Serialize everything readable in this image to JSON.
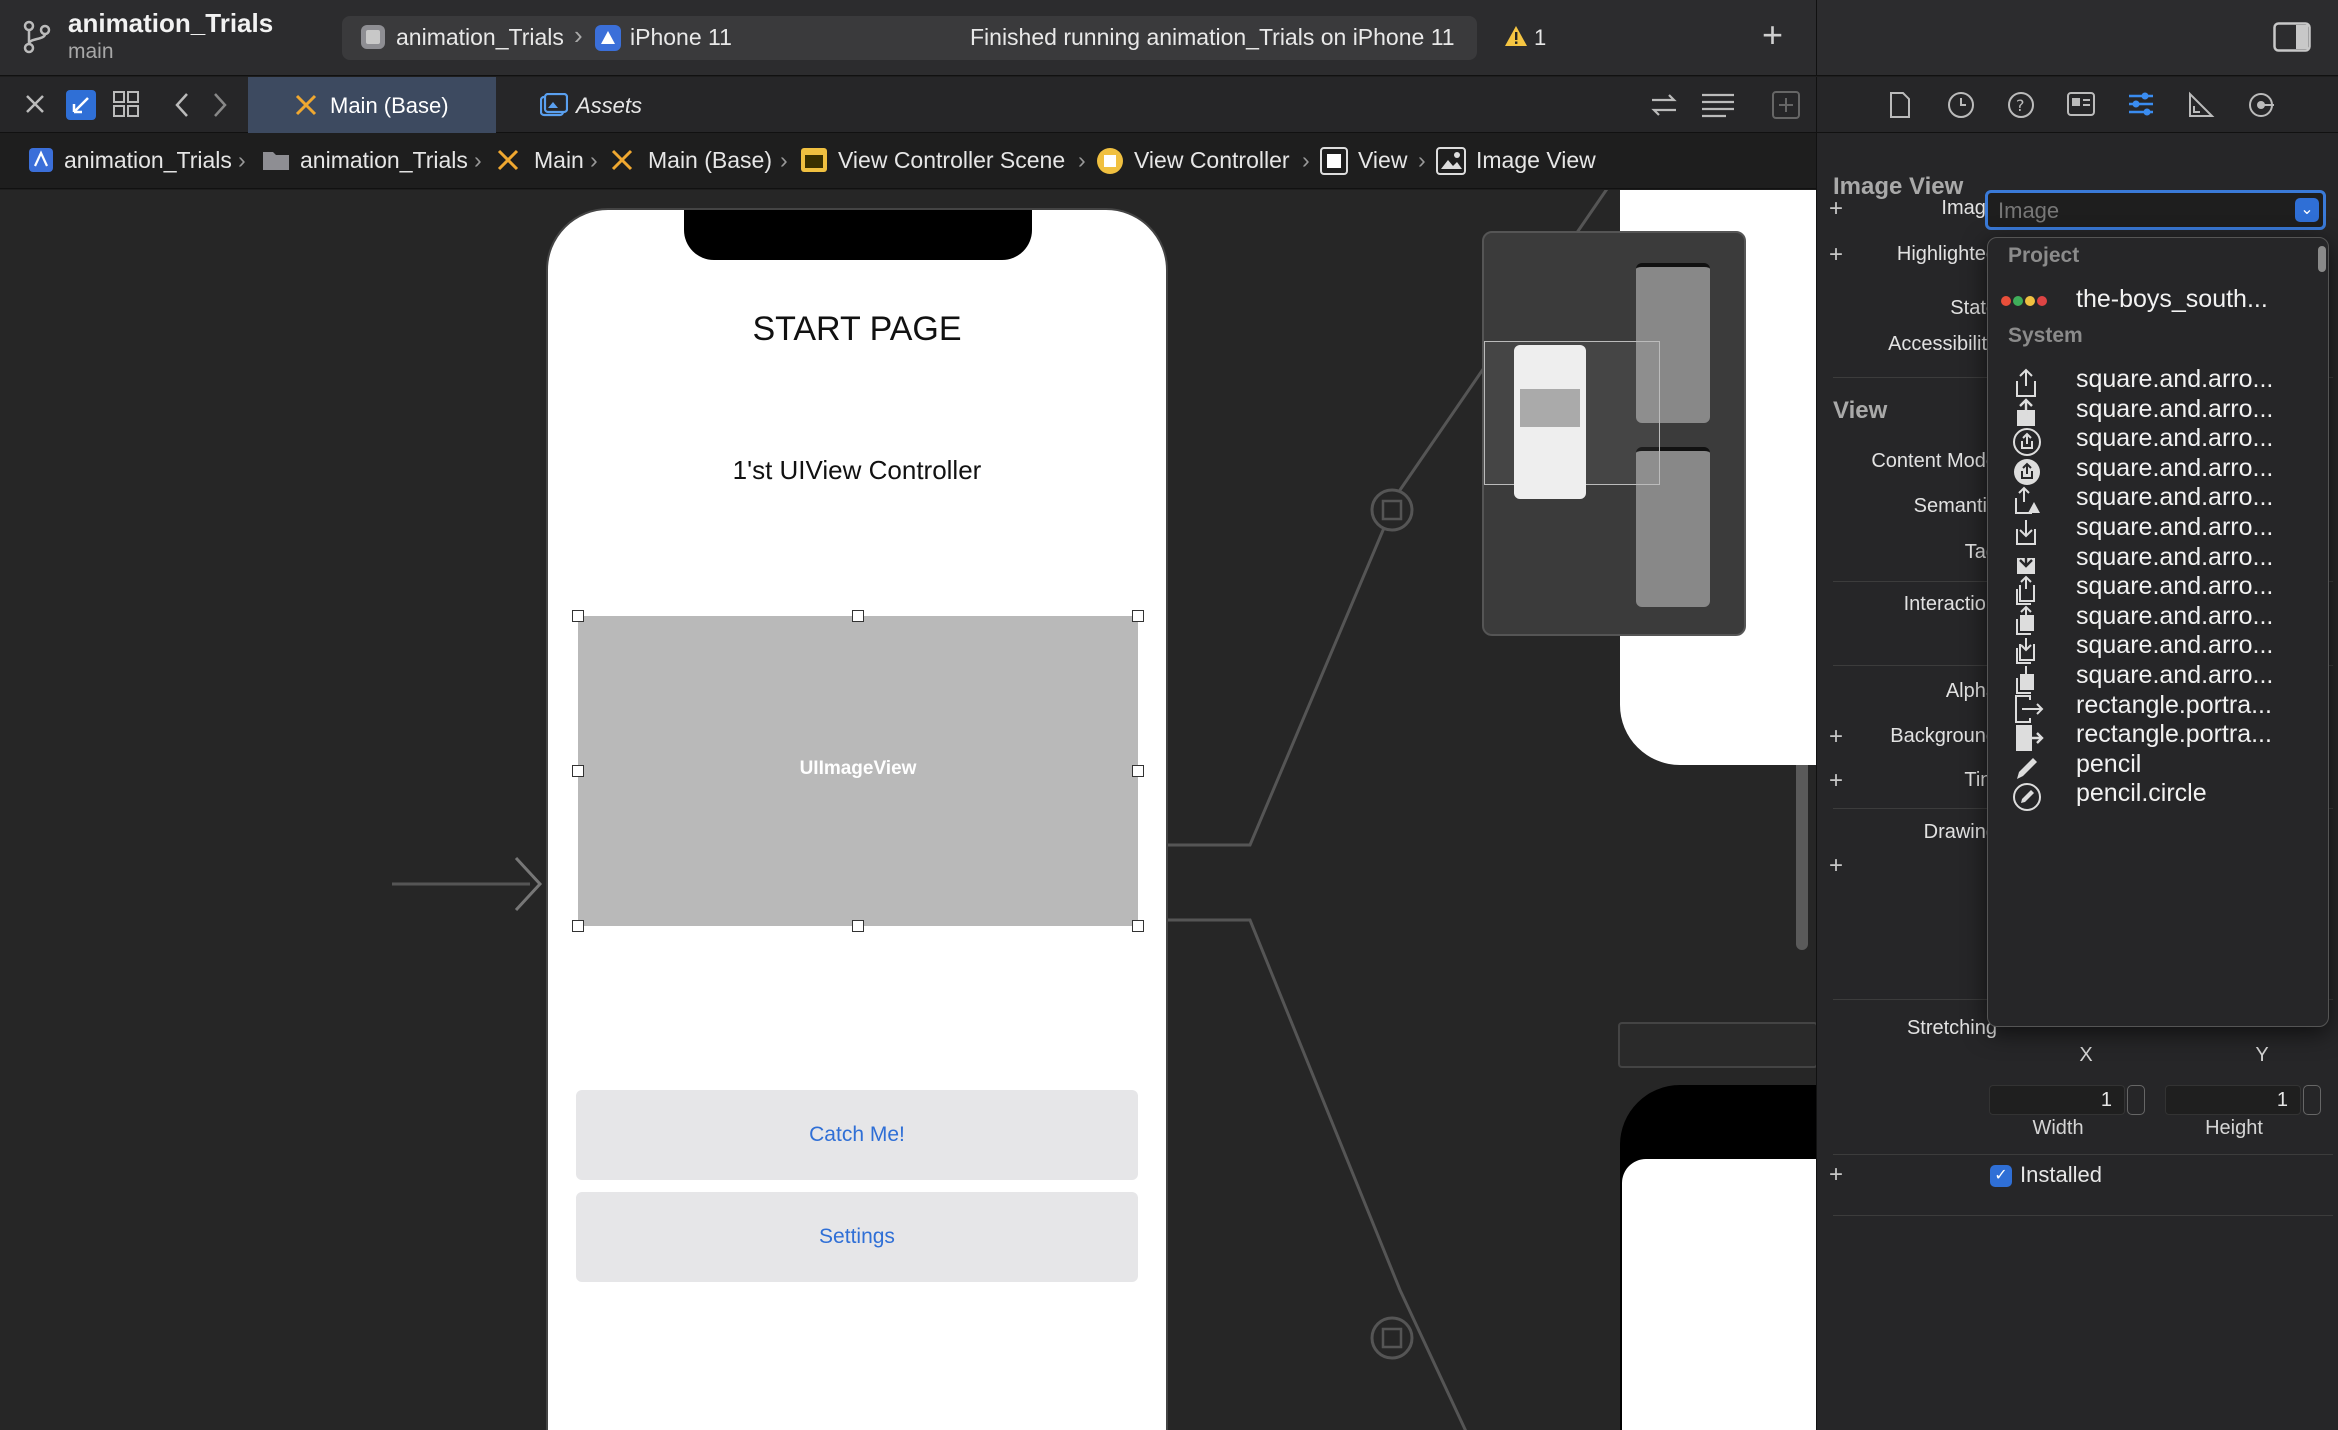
{
  "toolbar": {
    "project_name": "animation_Trials",
    "branch": "main",
    "scheme": "animation_Trials",
    "device": "iPhone 11",
    "status": "Finished running animation_Trials on iPhone 11",
    "warning_count": "1",
    "add_label": "+"
  },
  "tabs": [
    {
      "label": "Main (Base)",
      "active": true
    },
    {
      "label": "Assets",
      "active": false
    }
  ],
  "breadcrumbs": [
    "animation_Trials",
    "animation_Trials",
    "Main",
    "Main (Base)",
    "View Controller Scene",
    "View Controller",
    "View",
    "Image View"
  ],
  "canvas": {
    "title": "START PAGE",
    "subtitle": "1'st UIView Controller",
    "image_view_label": "UIImageView",
    "buttons": [
      "Catch Me!",
      "Settings"
    ]
  },
  "inspector": {
    "image_view_title": "Image View",
    "image_label": "Image",
    "image_placeholder": "Image",
    "highlighted_label": "Highlighted",
    "state_label": "State",
    "accessibility_label": "Accessibility",
    "view_title": "View",
    "content_mode_label": "Content Mode",
    "semantic_label": "Semantic",
    "tag_label": "Tag",
    "interaction_label": "Interaction",
    "alpha_label": "Alpha",
    "background_label": "Background",
    "tint_label": "Tint",
    "drawing_label": "Drawing",
    "stretching_label": "Stretching",
    "x_label": "X",
    "y_label": "Y",
    "width_label": "Width",
    "height_label": "Height",
    "width_value": "1",
    "height_value": "1",
    "installed_label": "Installed",
    "installed": true
  },
  "dropdown": {
    "project_header": "Project",
    "project_item": "the-boys_south...",
    "system_header": "System",
    "items": [
      "square.and.arro...",
      "square.and.arro...",
      "square.and.arro...",
      "square.and.arro...",
      "square.and.arro...",
      "square.and.arro...",
      "square.and.arro...",
      "square.and.arro...",
      "square.and.arro...",
      "square.and.arro...",
      "square.and.arro...",
      "rectangle.portra...",
      "rectangle.portra...",
      "pencil",
      "pencil.circle"
    ]
  },
  "colors": {
    "accent": "#2f6fd6",
    "active_tab": "#3d4a60",
    "warning": "#f5c542"
  }
}
